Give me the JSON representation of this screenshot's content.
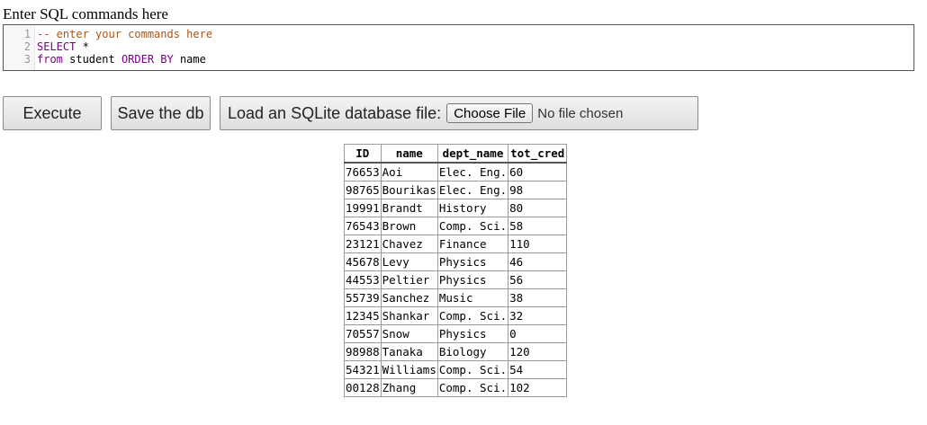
{
  "prompt_label": "Enter SQL commands here",
  "editor": {
    "lines": [
      {
        "number": "1",
        "tokens": [
          {
            "text": "-- enter your commands here",
            "kind": "comment"
          }
        ]
      },
      {
        "number": "2",
        "tokens": [
          {
            "text": "SELECT",
            "kind": "keyword"
          },
          {
            "text": " *",
            "kind": "plain"
          }
        ]
      },
      {
        "number": "3",
        "tokens": [
          {
            "text": "from",
            "kind": "keyword"
          },
          {
            "text": " student ",
            "kind": "plain"
          },
          {
            "text": "ORDER BY",
            "kind": "keyword"
          },
          {
            "text": " name",
            "kind": "plain"
          }
        ]
      }
    ]
  },
  "buttons": {
    "execute": "Execute",
    "save": "Save the db",
    "load_label": "Load an SQLite database file:",
    "choose_file": "Choose File",
    "no_file": "No file chosen"
  },
  "results": {
    "columns": [
      "ID",
      "name",
      "dept_name",
      "tot_cred"
    ],
    "rows": [
      [
        "76653",
        "Aoi",
        "Elec. Eng.",
        "60"
      ],
      [
        "98765",
        "Bourikas",
        "Elec. Eng.",
        "98"
      ],
      [
        "19991",
        "Brandt",
        "History",
        "80"
      ],
      [
        "76543",
        "Brown",
        "Comp. Sci.",
        "58"
      ],
      [
        "23121",
        "Chavez",
        "Finance",
        "110"
      ],
      [
        "45678",
        "Levy",
        "Physics",
        "46"
      ],
      [
        "44553",
        "Peltier",
        "Physics",
        "56"
      ],
      [
        "55739",
        "Sanchez",
        "Music",
        "38"
      ],
      [
        "12345",
        "Shankar",
        "Comp. Sci.",
        "32"
      ],
      [
        "70557",
        "Snow",
        "Physics",
        "0"
      ],
      [
        "98988",
        "Tanaka",
        "Biology",
        "120"
      ],
      [
        "54321",
        "Williams",
        "Comp. Sci.",
        "54"
      ],
      [
        "00128",
        "Zhang",
        "Comp. Sci.",
        "102"
      ]
    ]
  },
  "colors": {
    "comment": "#a8551c",
    "keyword": "#770088"
  }
}
